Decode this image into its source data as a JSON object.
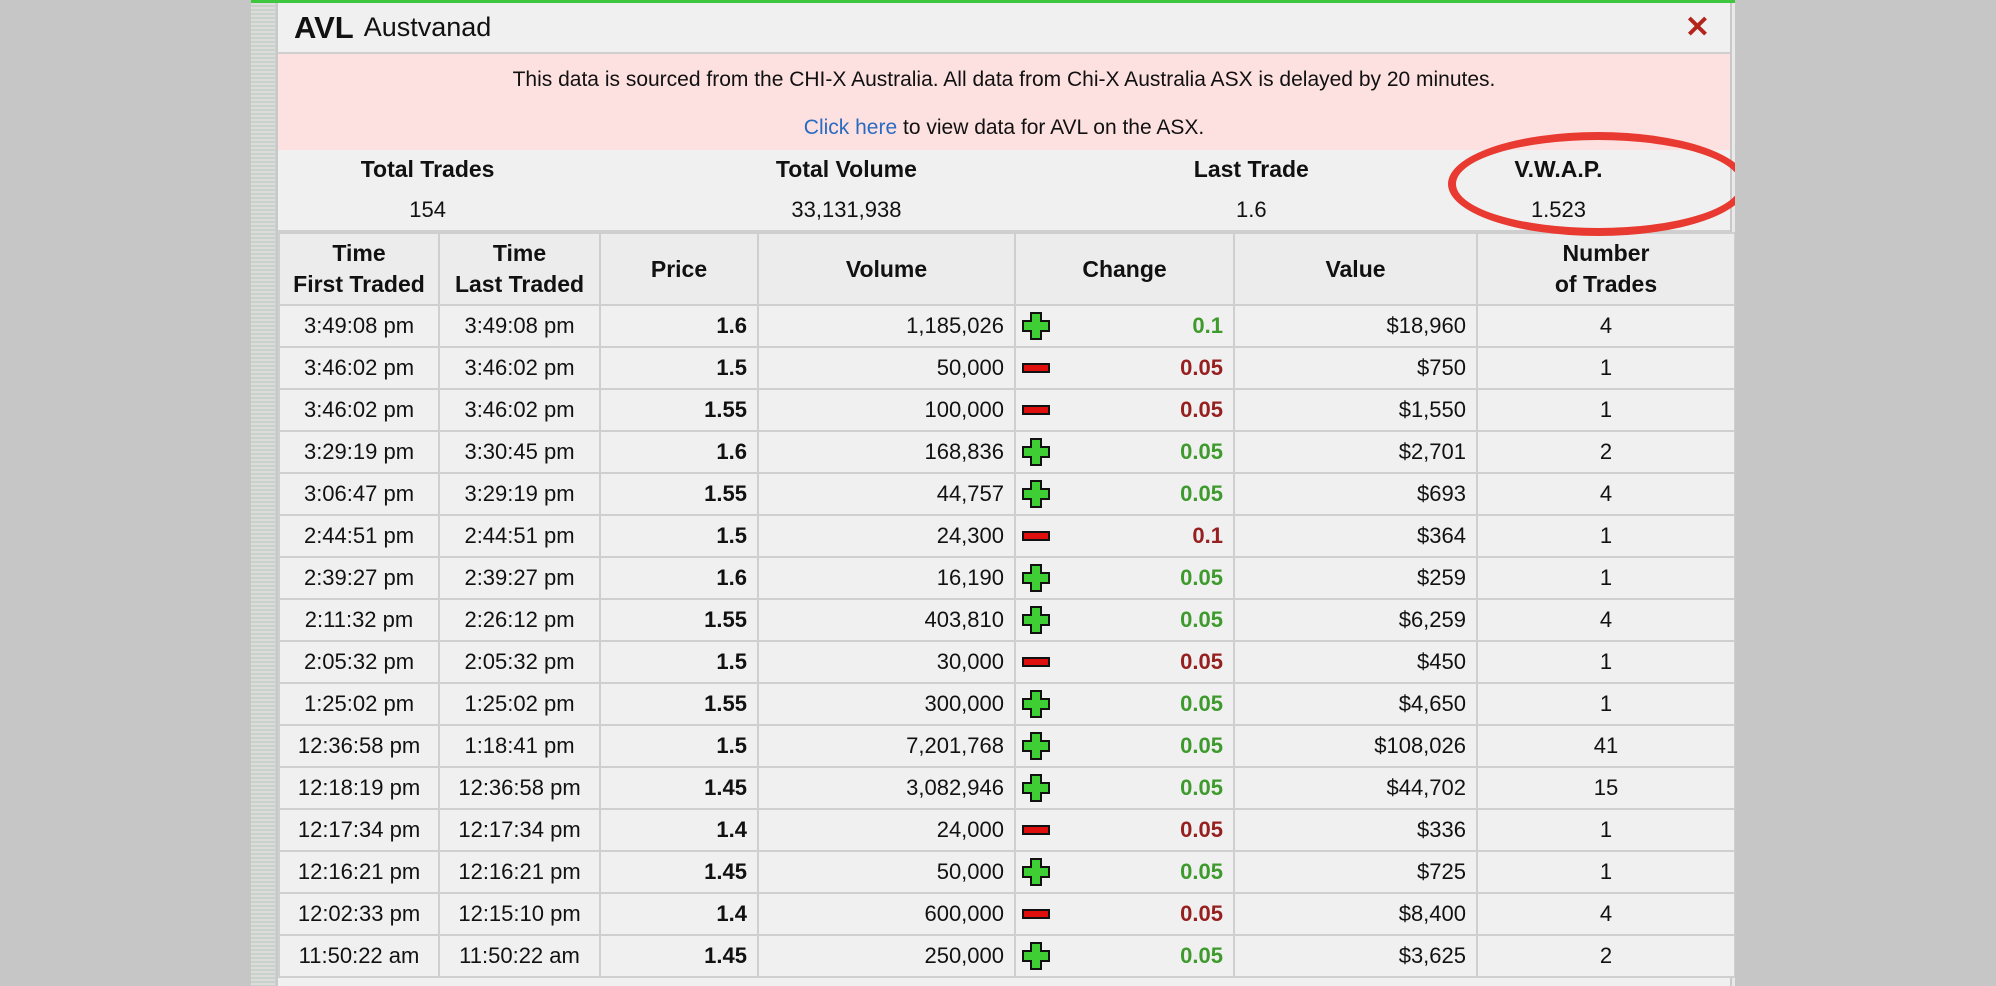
{
  "header": {
    "ticker": "AVL",
    "company": "Austvanad",
    "close_icon": "close-icon",
    "close_glyph": "✕"
  },
  "notice": {
    "text": "This data is sourced from the CHI-X Australia. All data from Chi-X Australia ASX is delayed by 20 minutes.",
    "link_text": "Click here",
    "link_suffix": " to view data for AVL on the ASX."
  },
  "summary": {
    "total_trades_label": "Total Trades",
    "total_trades": "154",
    "total_volume_label": "Total Volume",
    "total_volume": "33,131,938",
    "last_trade_label": "Last Trade",
    "last_trade": "1.6",
    "vwap_label": "V.W.A.P.",
    "vwap": "1.523"
  },
  "colors": {
    "accent_green": "#3fc63f",
    "up": "#3e9a2c",
    "down": "#962020",
    "highlight_ring": "#e83a30"
  },
  "table": {
    "columns": [
      {
        "line1": "Time",
        "line2": "First Traded"
      },
      {
        "line1": "Time",
        "line2": "Last Traded"
      },
      {
        "line1": "Price",
        "line2": ""
      },
      {
        "line1": "Volume",
        "line2": ""
      },
      {
        "line1": "Change",
        "line2": ""
      },
      {
        "line1": "Value",
        "line2": ""
      },
      {
        "line1": "Number",
        "line2": "of Trades"
      }
    ],
    "rows": [
      {
        "first": "3:49:08 pm",
        "last": "3:49:08 pm",
        "price": "1.6",
        "volume": "1,185,026",
        "dir": "up",
        "change": "0.1",
        "value": "$18,960",
        "trades": "4"
      },
      {
        "first": "3:46:02 pm",
        "last": "3:46:02 pm",
        "price": "1.5",
        "volume": "50,000",
        "dir": "down",
        "change": "0.05",
        "value": "$750",
        "trades": "1"
      },
      {
        "first": "3:46:02 pm",
        "last": "3:46:02 pm",
        "price": "1.55",
        "volume": "100,000",
        "dir": "down",
        "change": "0.05",
        "value": "$1,550",
        "trades": "1"
      },
      {
        "first": "3:29:19 pm",
        "last": "3:30:45 pm",
        "price": "1.6",
        "volume": "168,836",
        "dir": "up",
        "change": "0.05",
        "value": "$2,701",
        "trades": "2"
      },
      {
        "first": "3:06:47 pm",
        "last": "3:29:19 pm",
        "price": "1.55",
        "volume": "44,757",
        "dir": "up",
        "change": "0.05",
        "value": "$693",
        "trades": "4"
      },
      {
        "first": "2:44:51 pm",
        "last": "2:44:51 pm",
        "price": "1.5",
        "volume": "24,300",
        "dir": "down",
        "change": "0.1",
        "value": "$364",
        "trades": "1"
      },
      {
        "first": "2:39:27 pm",
        "last": "2:39:27 pm",
        "price": "1.6",
        "volume": "16,190",
        "dir": "up",
        "change": "0.05",
        "value": "$259",
        "trades": "1"
      },
      {
        "first": "2:11:32 pm",
        "last": "2:26:12 pm",
        "price": "1.55",
        "volume": "403,810",
        "dir": "up",
        "change": "0.05",
        "value": "$6,259",
        "trades": "4"
      },
      {
        "first": "2:05:32 pm",
        "last": "2:05:32 pm",
        "price": "1.5",
        "volume": "30,000",
        "dir": "down",
        "change": "0.05",
        "value": "$450",
        "trades": "1"
      },
      {
        "first": "1:25:02 pm",
        "last": "1:25:02 pm",
        "price": "1.55",
        "volume": "300,000",
        "dir": "up",
        "change": "0.05",
        "value": "$4,650",
        "trades": "1"
      },
      {
        "first": "12:36:58 pm",
        "last": "1:18:41 pm",
        "price": "1.5",
        "volume": "7,201,768",
        "dir": "up",
        "change": "0.05",
        "value": "$108,026",
        "trades": "41"
      },
      {
        "first": "12:18:19 pm",
        "last": "12:36:58 pm",
        "price": "1.45",
        "volume": "3,082,946",
        "dir": "up",
        "change": "0.05",
        "value": "$44,702",
        "trades": "15"
      },
      {
        "first": "12:17:34 pm",
        "last": "12:17:34 pm",
        "price": "1.4",
        "volume": "24,000",
        "dir": "down",
        "change": "0.05",
        "value": "$336",
        "trades": "1"
      },
      {
        "first": "12:16:21 pm",
        "last": "12:16:21 pm",
        "price": "1.45",
        "volume": "50,000",
        "dir": "up",
        "change": "0.05",
        "value": "$725",
        "trades": "1"
      },
      {
        "first": "12:02:33 pm",
        "last": "12:15:10 pm",
        "price": "1.4",
        "volume": "600,000",
        "dir": "down",
        "change": "0.05",
        "value": "$8,400",
        "trades": "4"
      },
      {
        "first": "11:50:22 am",
        "last": "11:50:22 am",
        "price": "1.45",
        "volume": "250,000",
        "dir": "up",
        "change": "0.05",
        "value": "$3,625",
        "trades": "2"
      }
    ]
  }
}
